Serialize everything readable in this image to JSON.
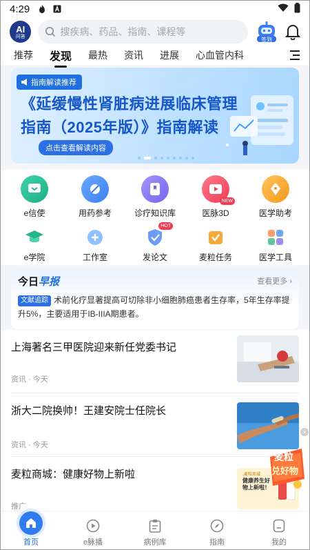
{
  "status_bar": {
    "time": "4:29",
    "icons": [
      "flame-icon",
      "a-icon",
      "wifi-icon",
      "battery-icon"
    ]
  },
  "header": {
    "logo_top": "AI",
    "logo_bottom": "问答",
    "search_placeholder": "搜疾病、药品、指南、课程等",
    "checkin_label": "签到"
  },
  "tabs": [
    {
      "label": "推荐"
    },
    {
      "label": "发现",
      "active": true
    },
    {
      "label": "最热"
    },
    {
      "label": "资讯"
    },
    {
      "label": "进展"
    },
    {
      "label": "心血管内科"
    }
  ],
  "banner": {
    "tag": "指南解读推荐",
    "title": "《延缓慢性肾脏病进展临床管理指南（2025年版）》指南解读",
    "cta": "点击查看解读内容"
  },
  "grid": {
    "row1": [
      {
        "label": "e信使",
        "icon": "chat-icon",
        "color": "#2fc29b"
      },
      {
        "label": "用药参考",
        "icon": "pill-icon",
        "color": "#4f8ef5"
      },
      {
        "label": "诊疗知识库",
        "icon": "bookmark-icon",
        "color": "#8a7cf0"
      },
      {
        "label": "医脉3D",
        "icon": "play-icon",
        "color": "#f5556b",
        "badge": "NEW"
      },
      {
        "label": "医学助考",
        "icon": "pen-icon",
        "color": "#f7a234"
      }
    ],
    "row2": [
      {
        "label": "e学院",
        "icon": "graduation-cap-icon",
        "color": "#2fb98f"
      },
      {
        "label": "工作室",
        "icon": "studio-icon",
        "color": "#6fa8f5"
      },
      {
        "label": "发论文",
        "icon": "shield-icon",
        "color": "#5b8ef0",
        "badge": "HOT"
      },
      {
        "label": "麦粒任务",
        "icon": "check-bag-icon",
        "color": "#f5a33a"
      },
      {
        "label": "医学工具",
        "icon": "apps-icon",
        "color": "#6dc1a0"
      }
    ]
  },
  "report": {
    "title_a": "今日",
    "title_b": "早报",
    "more": "查看更多",
    "tag": "文献追踪",
    "text": "术前化疗显著提高可切除非小细胞肺癌患者生存率，5年生存率提升5%，主要适用于IB-IIIA期患者。"
  },
  "news": [
    {
      "title": "上海著名三甲医院迎来新任党委书记",
      "meta": "资讯 · 今天"
    },
    {
      "title": "浙大二院换帅！王建安院士任院长",
      "meta": "资讯 · 今天"
    },
    {
      "title": "麦粒商城：健康好物上新啦",
      "meta": "推广",
      "thumb_text_top": "麦粒商城",
      "thumb_text_main": "健康养生好物上新啦！"
    }
  ],
  "float_badge": {
    "line1": "麦粒",
    "line2": "兑好物"
  },
  "bottom_nav": [
    {
      "label": "首页",
      "icon": "home-icon",
      "active": true
    },
    {
      "label": "e脉播",
      "icon": "play-circle-icon"
    },
    {
      "label": "病例库",
      "icon": "clipboard-icon"
    },
    {
      "label": "指南",
      "icon": "compass-icon"
    },
    {
      "label": "我的",
      "icon": "user-icon"
    }
  ]
}
